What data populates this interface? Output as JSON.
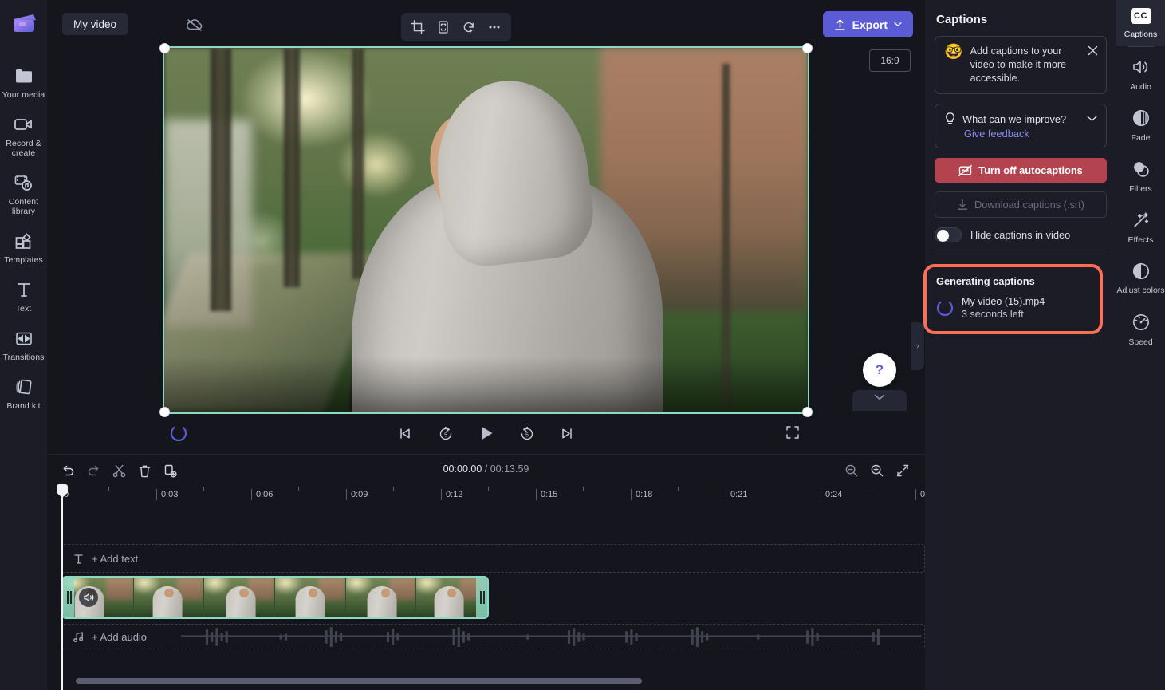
{
  "left_rail": {
    "logo_name": "clipchamp-logo",
    "items": [
      {
        "icon": "folder-icon",
        "label": "Your media"
      },
      {
        "icon": "video-camera-icon",
        "label": "Record & create"
      },
      {
        "icon": "content-library-icon",
        "label": "Content library"
      },
      {
        "icon": "templates-icon",
        "label": "Templates"
      },
      {
        "icon": "text-icon",
        "label": "Text"
      },
      {
        "icon": "transitions-icon",
        "label": "Transitions"
      },
      {
        "icon": "brand-kit-icon",
        "label": "Brand kit"
      }
    ],
    "collapse_chevron": "›"
  },
  "topbar": {
    "project_name": "My video",
    "cloud_off_icon": "cloud-off-icon",
    "tools": [
      {
        "icon": "crop-icon",
        "name": "crop-tool"
      },
      {
        "icon": "fit-icon",
        "name": "fit-tool"
      },
      {
        "icon": "rotate-icon",
        "name": "rotate-tool"
      },
      {
        "icon": "more-icon",
        "name": "more-options"
      }
    ],
    "export_label": "Export",
    "export_chevron": "∨",
    "export_color": "#5b5bd6"
  },
  "preview": {
    "aspect_ratio": "16:9",
    "selection_color": "#8fd9c4",
    "handles": [
      "top-left",
      "top-right",
      "bottom-left",
      "bottom-right"
    ]
  },
  "playback": {
    "spinner_name": "processing-spinner",
    "spinner_color": "#5b5bd6",
    "controls": [
      {
        "name": "skip-to-start-button",
        "icon": "skip-start-icon"
      },
      {
        "name": "rewind-5-button",
        "icon": "rewind-5-icon",
        "label": "5"
      },
      {
        "name": "play-button",
        "icon": "play-icon"
      },
      {
        "name": "forward-5-button",
        "icon": "forward-5-icon",
        "label": "5"
      },
      {
        "name": "skip-to-end-button",
        "icon": "skip-end-icon"
      }
    ],
    "fullscreen_icon": "fullscreen-icon"
  },
  "help": {
    "icon": "question-mark-icon",
    "tray_chevron": "∨"
  },
  "timeline": {
    "toolbar": [
      {
        "name": "undo-button",
        "icon": "undo-icon"
      },
      {
        "name": "redo-button",
        "icon": "redo-icon"
      },
      {
        "name": "split-button",
        "icon": "scissors-icon"
      },
      {
        "name": "delete-button",
        "icon": "trash-icon"
      },
      {
        "name": "duplicate-button",
        "icon": "duplicate-icon"
      }
    ],
    "current_time": "00:00.00",
    "total_time": "/ 00:13.59",
    "zoom_out_icon": "zoom-out-icon",
    "zoom_in_icon": "zoom-in-icon",
    "fit-icon": "fit-timeline-icon",
    "ruler_labels": [
      "0",
      "0:03",
      "0:06",
      "0:09",
      "0:12",
      "0:15",
      "0:18",
      "0:21",
      "0:24",
      "0"
    ],
    "add_text_label": "+ Add text",
    "add_text_icon": "text-icon",
    "add_audio_label": "+ Add audio",
    "add_audio_icon": "music-note-icon",
    "clip": {
      "name": "video-clip",
      "border_color": "#8fd9c4",
      "audio_badge_icon": "speaker-icon",
      "thumbnail_count": 6
    },
    "playhead_position_label": "0"
  },
  "right_panel": {
    "title": "Captions",
    "promo": {
      "emoji": "🤓",
      "emoji_name": "nerd-face-emoji",
      "text": "Add captions to your video to make it more accessible.",
      "close_icon": "close-icon"
    },
    "feedback": {
      "bulb_icon": "lightbulb-icon",
      "question": "What can we improve?",
      "chevron": "chevron-down-icon",
      "link": "Give feedback",
      "link_color": "#8b8bf0"
    },
    "turn_off": {
      "label": "Turn off autocaptions",
      "icon": "captions-off-icon",
      "color": "#b2434f"
    },
    "download": {
      "label": "Download captions (.srt)",
      "icon": "download-icon",
      "disabled": true
    },
    "hide_toggle": {
      "label": "Hide captions in video",
      "state": "off"
    },
    "generating": {
      "title": "Generating captions",
      "file_name": "My video (15).mp4",
      "time_left": "3 seconds left",
      "spinner_name": "loading-spinner",
      "spinner_color": "#5b5bd6",
      "highlight_color": "#ff6f55"
    },
    "collapse_chevron": "›"
  },
  "right_rail": {
    "active": {
      "badge": "CC",
      "label": "Captions"
    },
    "items": [
      {
        "icon": "speaker-icon",
        "label": "Audio"
      },
      {
        "icon": "fade-icon",
        "label": "Fade"
      },
      {
        "icon": "filters-icon",
        "label": "Filters"
      },
      {
        "icon": "magic-wand-icon",
        "label": "Effects"
      },
      {
        "icon": "contrast-icon",
        "label": "Adjust colors"
      },
      {
        "icon": "speedometer-icon",
        "label": "Speed"
      }
    ]
  }
}
